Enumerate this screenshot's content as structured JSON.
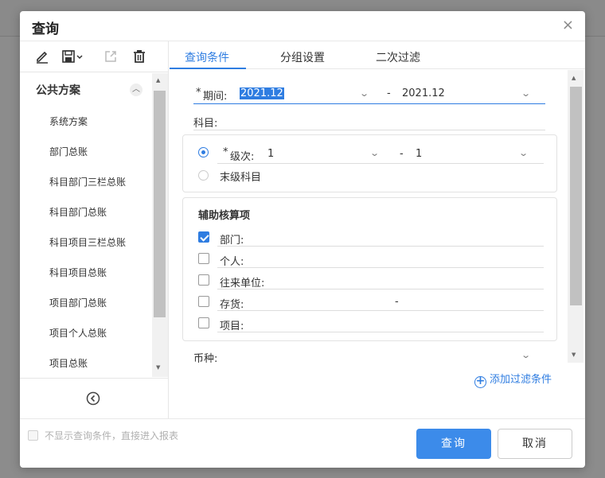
{
  "dialog": {
    "title": "查询",
    "close_glyph": "×"
  },
  "toolbar": {
    "icons": [
      "edit-icon",
      "save-icon",
      "export-icon",
      "delete-icon"
    ]
  },
  "schemes": {
    "group_title": "公共方案",
    "items": [
      "系统方案",
      "部门总账",
      "科目部门三栏总账",
      "科目部门总账",
      "科目项目三栏总账",
      "科目项目总账",
      "项目部门总账",
      "项目个人总账",
      "项目总账"
    ]
  },
  "tabs": [
    {
      "label": "查询条件",
      "active": true
    },
    {
      "label": "分组设置",
      "active": false
    },
    {
      "label": "二次过滤",
      "active": false
    }
  ],
  "form": {
    "period": {
      "label": "期间:",
      "required_mark": "*",
      "from": "2021.12",
      "separator": "-",
      "to": "2021.12"
    },
    "account": {
      "label": "科目:"
    },
    "level": {
      "label": "级次:",
      "required_mark": "*",
      "from": "1",
      "separator": "-",
      "to": "1",
      "selected": true
    },
    "leaf_account": {
      "label": "末级科目",
      "selected": false
    },
    "aux": {
      "title": "辅助核算项",
      "items": [
        {
          "label": "部门:",
          "checked": true,
          "value": ""
        },
        {
          "label": "个人:",
          "checked": false,
          "value": ""
        },
        {
          "label": "往来单位:",
          "checked": false,
          "value": ""
        },
        {
          "label": "存货:",
          "checked": false,
          "value": "-"
        },
        {
          "label": "项目:",
          "checked": false,
          "value": ""
        }
      ]
    },
    "currency": {
      "label": "币种:"
    },
    "add_filter_label": "添加过滤条件"
  },
  "footer": {
    "skip_label": "不显示查询条件，直接进入报表",
    "query_button": "查询",
    "cancel_button": "取消"
  },
  "colors": {
    "accent": "#2f7de1",
    "primary_button": "#3c8bea",
    "required": "#e4393c"
  }
}
